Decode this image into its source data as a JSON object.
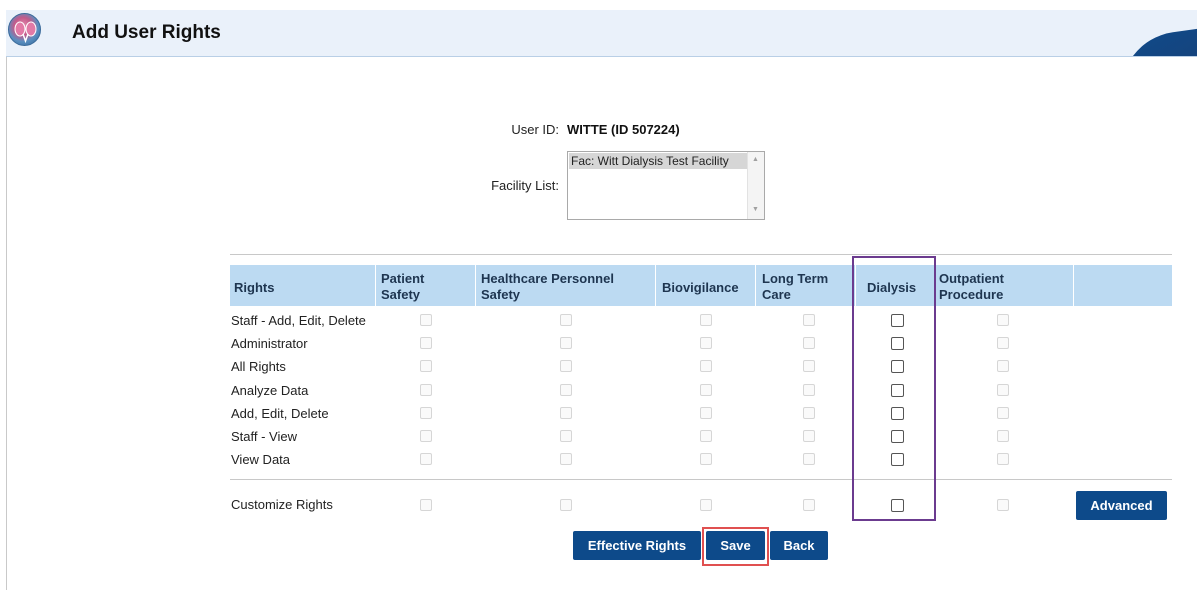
{
  "header": {
    "title": "Add User Rights",
    "logo_icon": "kidney-logo-icon"
  },
  "form": {
    "user_id_label": "User ID:",
    "user_id_value": "WITTE (ID 507224)",
    "facility_list_label": "Facility List:",
    "facility_options": [
      "Fac: Witt Dialysis Test Facility"
    ]
  },
  "rights_table": {
    "columns": [
      {
        "key": "rights",
        "label_line1": "Rights",
        "label_line2": ""
      },
      {
        "key": "patient_safety",
        "label_line1": "Patient",
        "label_line2": "Safety"
      },
      {
        "key": "hps",
        "label_line1": "Healthcare Personnel",
        "label_line2": "Safety"
      },
      {
        "key": "biovigilance",
        "label_line1": "Biovigilance",
        "label_line2": ""
      },
      {
        "key": "ltc",
        "label_line1": "Long Term",
        "label_line2": "Care"
      },
      {
        "key": "dialysis",
        "label_line1": "Dialysis",
        "label_line2": ""
      },
      {
        "key": "outpatient",
        "label_line1": "Outpatient",
        "label_line2": "Procedure"
      }
    ],
    "rows": [
      {
        "label": "Staff - Add, Edit, Delete",
        "enabled": [
          false,
          false,
          false,
          false,
          true,
          false
        ]
      },
      {
        "label": "Administrator",
        "enabled": [
          false,
          false,
          false,
          false,
          true,
          false
        ]
      },
      {
        "label": "All Rights",
        "enabled": [
          false,
          false,
          false,
          false,
          true,
          false
        ]
      },
      {
        "label": "Analyze Data",
        "enabled": [
          false,
          false,
          false,
          false,
          true,
          false
        ]
      },
      {
        "label": "Add, Edit, Delete",
        "enabled": [
          false,
          false,
          false,
          false,
          true,
          false
        ]
      },
      {
        "label": "Staff - View",
        "enabled": [
          false,
          false,
          false,
          false,
          true,
          false
        ]
      },
      {
        "label": "View Data",
        "enabled": [
          false,
          false,
          false,
          false,
          true,
          false
        ]
      }
    ],
    "customize": {
      "label": "Customize Rights",
      "enabled": [
        false,
        false,
        false,
        false,
        true,
        false
      ]
    }
  },
  "buttons": {
    "advanced": "Advanced",
    "effective_rights": "Effective Rights",
    "save": "Save",
    "back": "Back"
  },
  "colors": {
    "header_bg": "#eaf1fa",
    "table_header_bg": "#bcdaf2",
    "button_bg": "#0d4a8a",
    "dialysis_highlight": "#6b3b8f",
    "save_highlight": "#e05050"
  }
}
